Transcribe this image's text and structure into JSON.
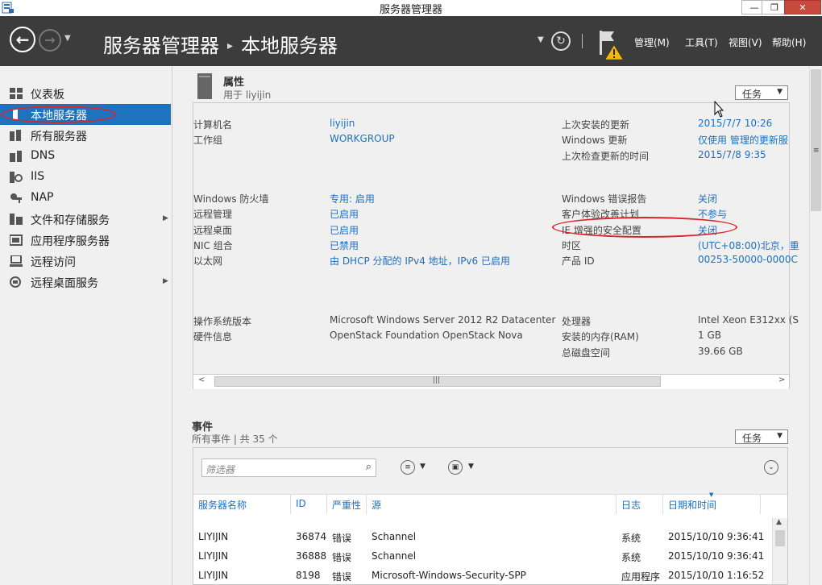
{
  "window": {
    "title": "服务器管理器",
    "min": "—",
    "restore": "❐",
    "close": "✕"
  },
  "header": {
    "breadcrumb_root": "服务器管理器",
    "breadcrumb_sep": "▸",
    "breadcrumb_current": "本地服务器",
    "menus": [
      "管理(M)",
      "工具(T)",
      "视图(V)",
      "帮助(H)"
    ]
  },
  "sidebar": {
    "items": [
      {
        "label": "仪表板",
        "icon": "dashboard-icon"
      },
      {
        "label": "本地服务器",
        "icon": "server-icon",
        "selected": true
      },
      {
        "label": "所有服务器",
        "icon": "servers-icon"
      },
      {
        "label": "DNS",
        "icon": "dns-icon"
      },
      {
        "label": "IIS",
        "icon": "iis-icon"
      },
      {
        "label": "NAP",
        "icon": "nap-icon"
      },
      {
        "label": "文件和存储服务",
        "icon": "storage-icon",
        "expandable": true
      },
      {
        "label": "应用程序服务器",
        "icon": "app-server-icon"
      },
      {
        "label": "远程访问",
        "icon": "remote-access-icon"
      },
      {
        "label": "远程桌面服务",
        "icon": "remote-desktop-icon",
        "expandable": true
      }
    ]
  },
  "properties": {
    "title": "属性",
    "subtitle": "用于 liyijin",
    "task_label": "任务",
    "rows_left": [
      {
        "label": "计算机名",
        "value": "liyijin"
      },
      {
        "label": "工作组",
        "value": "WORKGROUP"
      },
      {
        "label": "Windows 防火墙",
        "value": "专用: 启用"
      },
      {
        "label": "远程管理",
        "value": "已启用"
      },
      {
        "label": "远程桌面",
        "value": "已启用"
      },
      {
        "label": "NIC 组合",
        "value": "已禁用"
      },
      {
        "label": "以太网",
        "value": "由 DHCP 分配的 IPv4 地址，IPv6 已启用"
      },
      {
        "label": "操作系统版本",
        "value": "Microsoft Windows Server 2012 R2 Datacenter"
      },
      {
        "label": "硬件信息",
        "value": "OpenStack Foundation OpenStack Nova"
      }
    ],
    "rows_right": [
      {
        "label": "上次安装的更新",
        "value": "2015/7/7 10:26"
      },
      {
        "label": "Windows 更新",
        "value": "仅使用 管理的更新服"
      },
      {
        "label": "上次检查更新的时间",
        "value": "2015/7/8 9:35"
      },
      {
        "label": "Windows 错误报告",
        "value": "关闭"
      },
      {
        "label": "客户体验改善计划",
        "value": "不参与"
      },
      {
        "label": "IE 增强的安全配置",
        "value": "关闭"
      },
      {
        "label": "时区",
        "value": "(UTC+08:00)北京，重"
      },
      {
        "label": "产品 ID",
        "value": "00253-50000-0000C"
      },
      {
        "label": "处理器",
        "value": "Intel Xeon E312xx (S"
      },
      {
        "label": "安装的内存(RAM)",
        "value": "1 GB"
      },
      {
        "label": "总磁盘空间",
        "value": "39.66 GB"
      }
    ]
  },
  "events": {
    "title": "事件",
    "subtitle": "所有事件 | 共 35 个",
    "task_label": "任务",
    "filter_placeholder": "筛选器",
    "columns": [
      "服务器名称",
      "ID",
      "严重性",
      "源",
      "日志",
      "日期和时间"
    ],
    "rows": [
      [
        "LIYIJIN",
        "36874",
        "错误",
        "Schannel",
        "系统",
        "2015/10/10 9:36:41"
      ],
      [
        "LIYIJIN",
        "36888",
        "错误",
        "Schannel",
        "系统",
        "2015/10/10 9:36:41"
      ],
      [
        "LIYIJIN",
        "8198",
        "错误",
        "Microsoft-Windows-Security-SPP",
        "应用程序",
        "2015/10/10 1:16:52"
      ]
    ]
  }
}
